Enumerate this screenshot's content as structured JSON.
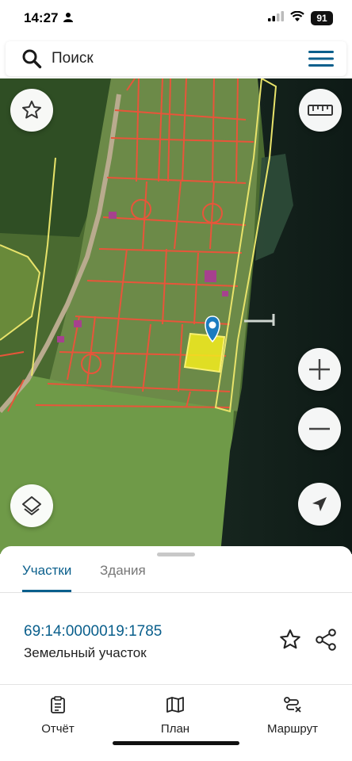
{
  "status_bar": {
    "time": "14:27",
    "battery": "91",
    "icons": [
      "person-icon",
      "signal-icon",
      "wifi-icon",
      "battery-icon"
    ]
  },
  "search": {
    "placeholder": "Поиск",
    "icon": "search-icon",
    "menu_icon": "menu-icon"
  },
  "map_controls": {
    "favorite_icon": "star-icon",
    "ruler_icon": "ruler-icon",
    "zoom_in_icon": "plus-icon",
    "zoom_out_icon": "minus-icon",
    "layers_icon": "layers-icon",
    "locate_icon": "navigation-arrow-icon"
  },
  "map": {
    "parcel_border_color": "#e8553a",
    "selected_parcel_color": "#f4ec1e",
    "zone_border_color": "#e8e36a",
    "marker_color": "#1b7bbf"
  },
  "sheet": {
    "tabs": [
      {
        "label": "Участки",
        "active": true
      },
      {
        "label": "Здания",
        "active": false
      }
    ],
    "parcel": {
      "number": "69:14:0000019:1785",
      "type": "Земельный участок"
    },
    "accent_color": "#0a5f8c"
  },
  "bottom_nav": [
    {
      "label": "Отчёт",
      "icon": "report-icon"
    },
    {
      "label": "План",
      "icon": "map-plan-icon"
    },
    {
      "label": "Маршрут",
      "icon": "route-icon"
    }
  ]
}
